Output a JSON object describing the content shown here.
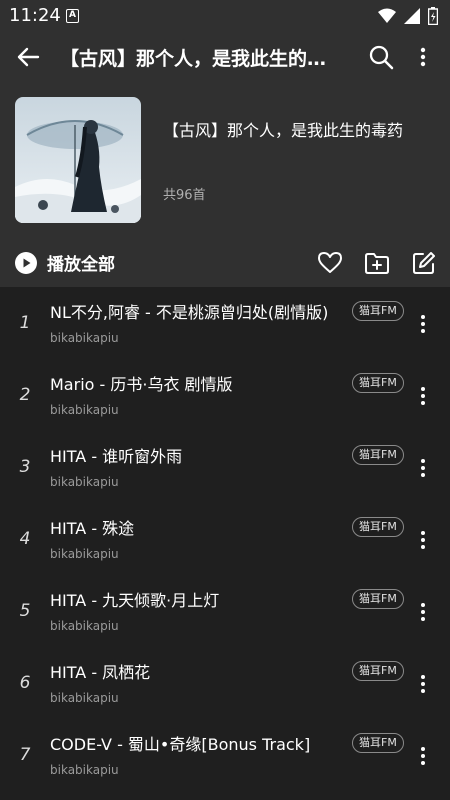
{
  "status_bar": {
    "time": "11:24",
    "notification": "A"
  },
  "app_bar": {
    "title": "【古风】那个人，是我此生的…",
    "back_icon": "arrow-left-icon",
    "search_icon": "search-icon",
    "menu_icon": "more-vertical-icon"
  },
  "playlist": {
    "title": "【古风】那个人，是我此生的毒药",
    "count": "共96首"
  },
  "actions": {
    "play_all": "播放全部",
    "icons": [
      "heart-icon",
      "folder-add-icon",
      "edit-icon"
    ]
  },
  "songs": [
    {
      "num": "1",
      "title": "NL不分,阿睿 - 不是桃源曾归处(剧情版)",
      "artist": "bikabikapiu",
      "source": "猫耳FM"
    },
    {
      "num": "2",
      "title": "Mario - 历书·乌衣 剧情版",
      "artist": "bikabikapiu",
      "source": "猫耳FM"
    },
    {
      "num": "3",
      "title": "HITA - 谁听窗外雨",
      "artist": "bikabikapiu",
      "source": "猫耳FM"
    },
    {
      "num": "4",
      "title": "HITA - 殊途",
      "artist": "bikabikapiu",
      "source": "猫耳FM"
    },
    {
      "num": "5",
      "title": "HITA - 九天倾歌·月上灯",
      "artist": "bikabikapiu",
      "source": "猫耳FM"
    },
    {
      "num": "6",
      "title": "HITA - 凤栖花",
      "artist": "bikabikapiu",
      "source": "猫耳FM"
    },
    {
      "num": "7",
      "title": "CODE-V - 蜀山•奇缘[Bonus Track]",
      "artist": "bikabikapiu",
      "source": "猫耳FM"
    }
  ]
}
